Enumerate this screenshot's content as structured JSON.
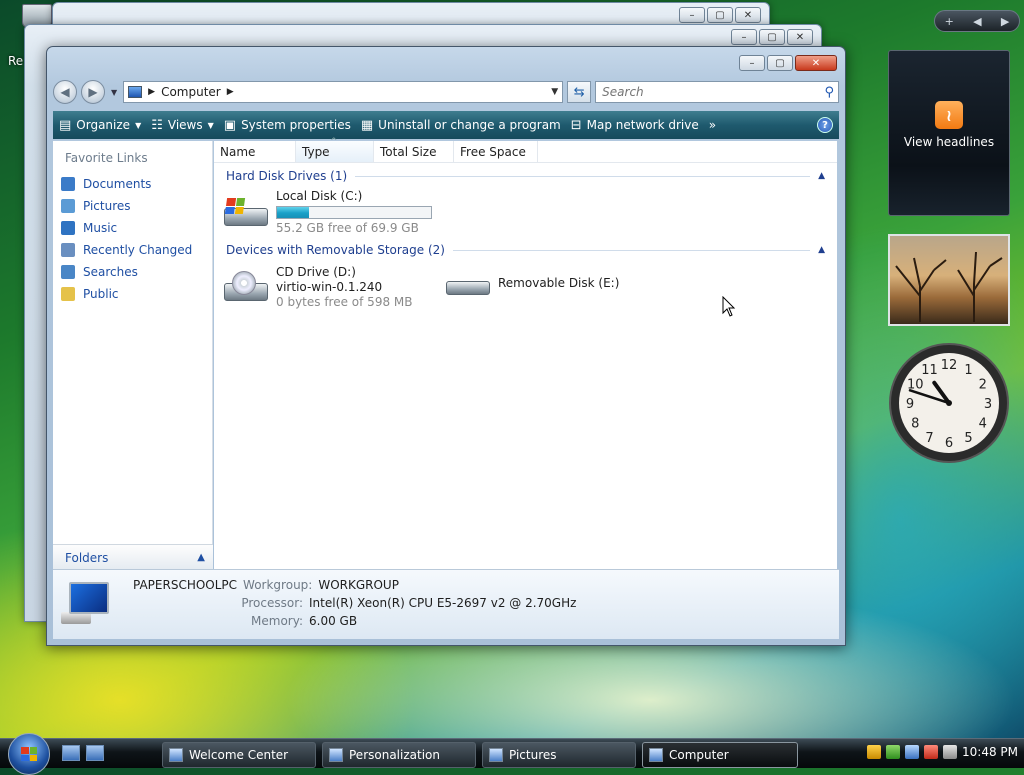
{
  "desktop": {
    "recycle_label": "Re"
  },
  "explorer": {
    "address": {
      "crumb": "Computer"
    },
    "search": {
      "placeholder": "Search"
    },
    "toolbar": [
      {
        "label": "Organize",
        "icon": "organize-icon",
        "dropdown": true
      },
      {
        "label": "Views",
        "icon": "views-icon",
        "dropdown": true
      },
      {
        "label": "System properties",
        "icon": "system-properties-icon"
      },
      {
        "label": "Uninstall or change a program",
        "icon": "uninstall-icon"
      },
      {
        "label": "Map network drive",
        "icon": "map-network-icon"
      }
    ],
    "toolbar_more": "»",
    "nav": {
      "heading": "Favorite Links",
      "items": [
        {
          "label": "Documents",
          "color": "#3b7bc8"
        },
        {
          "label": "Pictures",
          "color": "#5b9bd5"
        },
        {
          "label": "Music",
          "color": "#2f73c2"
        },
        {
          "label": "Recently Changed",
          "color": "#6a8fc0"
        },
        {
          "label": "Searches",
          "color": "#4a86c6"
        },
        {
          "label": "Public",
          "color": "#e5c24a"
        }
      ],
      "folders_label": "Folders"
    },
    "columns": [
      "Name",
      "Type",
      "Total Size",
      "Free Space"
    ],
    "groups": [
      {
        "title": "Hard Disk Drives (1)",
        "drives": [
          {
            "name": "Local Disk (C:)",
            "usage_fraction": 0.21,
            "detail": "55.2 GB free of 69.9 GB"
          }
        ]
      },
      {
        "title": "Devices with Removable Storage (2)",
        "drives": [
          {
            "name": "CD Drive (D:)",
            "label": "virtio-win-0.1.240",
            "detail": "0 bytes free of 598 MB"
          },
          {
            "name": "Removable Disk (E:)"
          }
        ]
      }
    ],
    "details": {
      "computer_name": "PAPERSCHOOLPC",
      "workgroup_label": "Workgroup:",
      "workgroup": "WORKGROUP",
      "processor_label": "Processor:",
      "processor": "Intel(R) Xeon(R) CPU E5-2697 v2 @ 2.70GHz",
      "memory_label": "Memory:",
      "memory": "6.00 GB"
    }
  },
  "sidebar": {
    "add_button": "+",
    "feed_label": "View headlines",
    "clock": {
      "hour": 10,
      "minute": 48
    }
  },
  "taskbar": {
    "buttons": [
      {
        "label": "Welcome Center"
      },
      {
        "label": "Personalization"
      },
      {
        "label": "Pictures"
      },
      {
        "label": "Computer",
        "active": true
      }
    ],
    "time": "10:48 PM"
  }
}
